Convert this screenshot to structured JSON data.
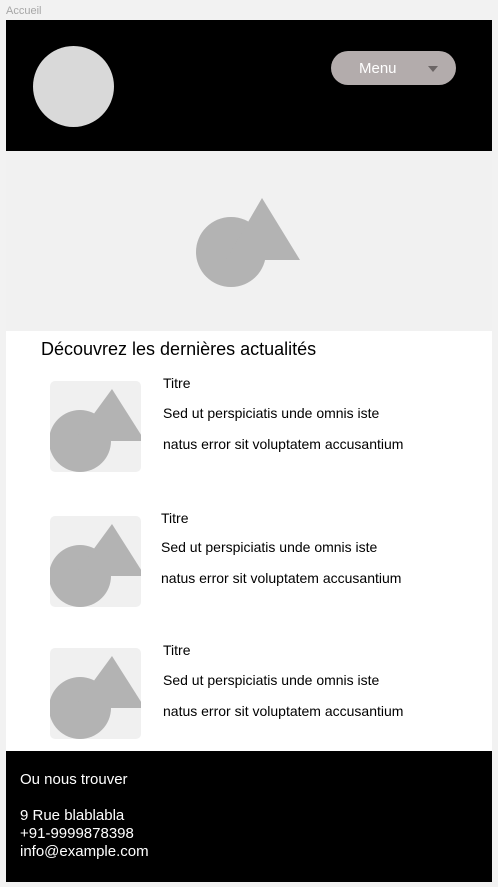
{
  "frame": {
    "label": "Accueil"
  },
  "header": {
    "menu_label": "Menu"
  },
  "news": {
    "heading": "Découvrez les dernières actualités",
    "items": [
      {
        "title": "Titre",
        "line1": "Sed ut perspiciatis unde omnis iste",
        "line2": "natus error sit voluptatem accusantium"
      },
      {
        "title": "Titre",
        "line1": "Sed ut perspiciatis unde omnis iste",
        "line2": "natus error sit voluptatem accusantium"
      },
      {
        "title": "Titre",
        "line1": "Sed ut perspiciatis unde omnis iste",
        "line2": "natus error sit voluptatem accusantium"
      }
    ]
  },
  "footer": {
    "heading": "Ou nous trouver",
    "address": "9 Rue blablabla",
    "phone": "+91-9999878398",
    "email": "info@example.com"
  },
  "colors": {
    "header_bg": "#000000",
    "menu_button_bg": "#b3acac",
    "placeholder_shape": "#b3b3b3",
    "hero_bg": "#f1f1f1"
  },
  "icons": {
    "hero": "image-placeholder-icon",
    "thumbnail": "image-placeholder-icon",
    "menu": "chevron-down-icon"
  }
}
